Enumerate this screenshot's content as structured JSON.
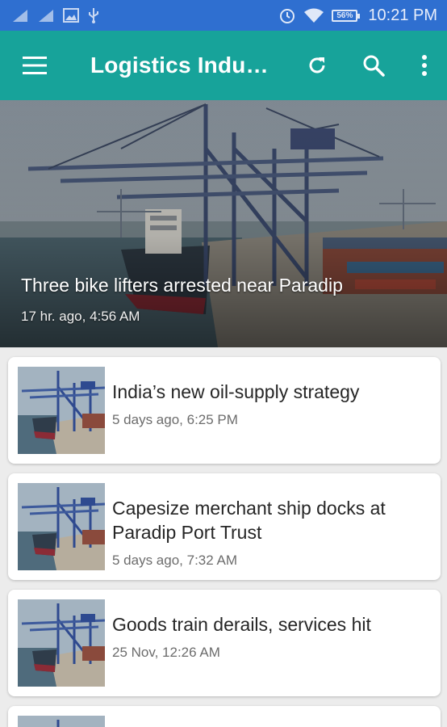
{
  "status_bar": {
    "battery_percent": "56%",
    "time": "10:21 PM"
  },
  "app_bar": {
    "title": "Logistics Indu…",
    "icons": [
      "menu-icon",
      "refresh-icon",
      "search-icon",
      "more-vert-icon"
    ]
  },
  "hero": {
    "title": "Three bike lifters arrested near Paradip",
    "time": "17 hr. ago, 4:56 AM"
  },
  "articles": [
    {
      "title": "India’s new oil-supply strategy",
      "time": "5 days ago, 6:25 PM"
    },
    {
      "title": "Capesize merchant ship docks at Paradip Port Trust",
      "time": "5 days ago, 7:32 AM"
    },
    {
      "title": "Goods train derails, services hit",
      "time": "25 Nov, 12:26 AM"
    }
  ],
  "colors": {
    "status_bar": "#2f6fd0",
    "app_bar": "#17a39a",
    "background": "#ececec"
  }
}
